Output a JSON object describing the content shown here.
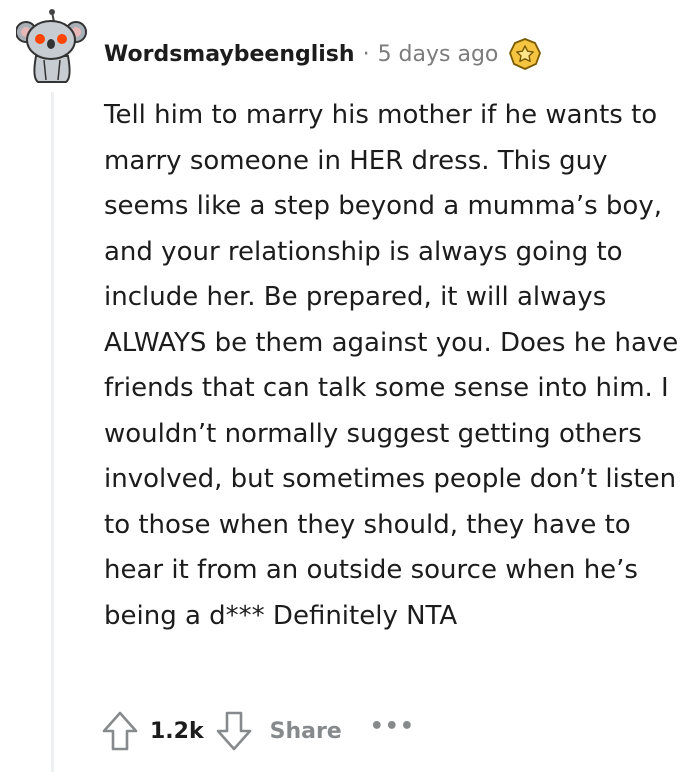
{
  "comment": {
    "username": "Wordsmaybeenglish",
    "separator": "·",
    "timestamp": "5 days ago",
    "award_icon": "gold-award-icon",
    "body": "Tell him to marry his mother if he wants to marry someone in HER dress. This guy seems like a step beyond a mumma’s boy, and your relationship is always going to include her. Be prepared, it will always ALWAYS be them against you. Does he have friends that can talk some sense into him. I wouldn’t normally suggest getting others involved, but sometimes people don’t listen to those when they should, they have to hear it from an outside source when he’s being a d*** Definitely NTA"
  },
  "actions": {
    "upvote_icon": "upvote-arrow-icon",
    "score": "1.2k",
    "downvote_icon": "downvote-arrow-icon",
    "share_label": "Share",
    "more_label": "•••"
  },
  "colors": {
    "text": "#1c1c1c",
    "meta": "#7c7c7c",
    "muted_action": "#878a8c",
    "thread_line": "#edeff1",
    "award_gold": "#f5c542"
  }
}
